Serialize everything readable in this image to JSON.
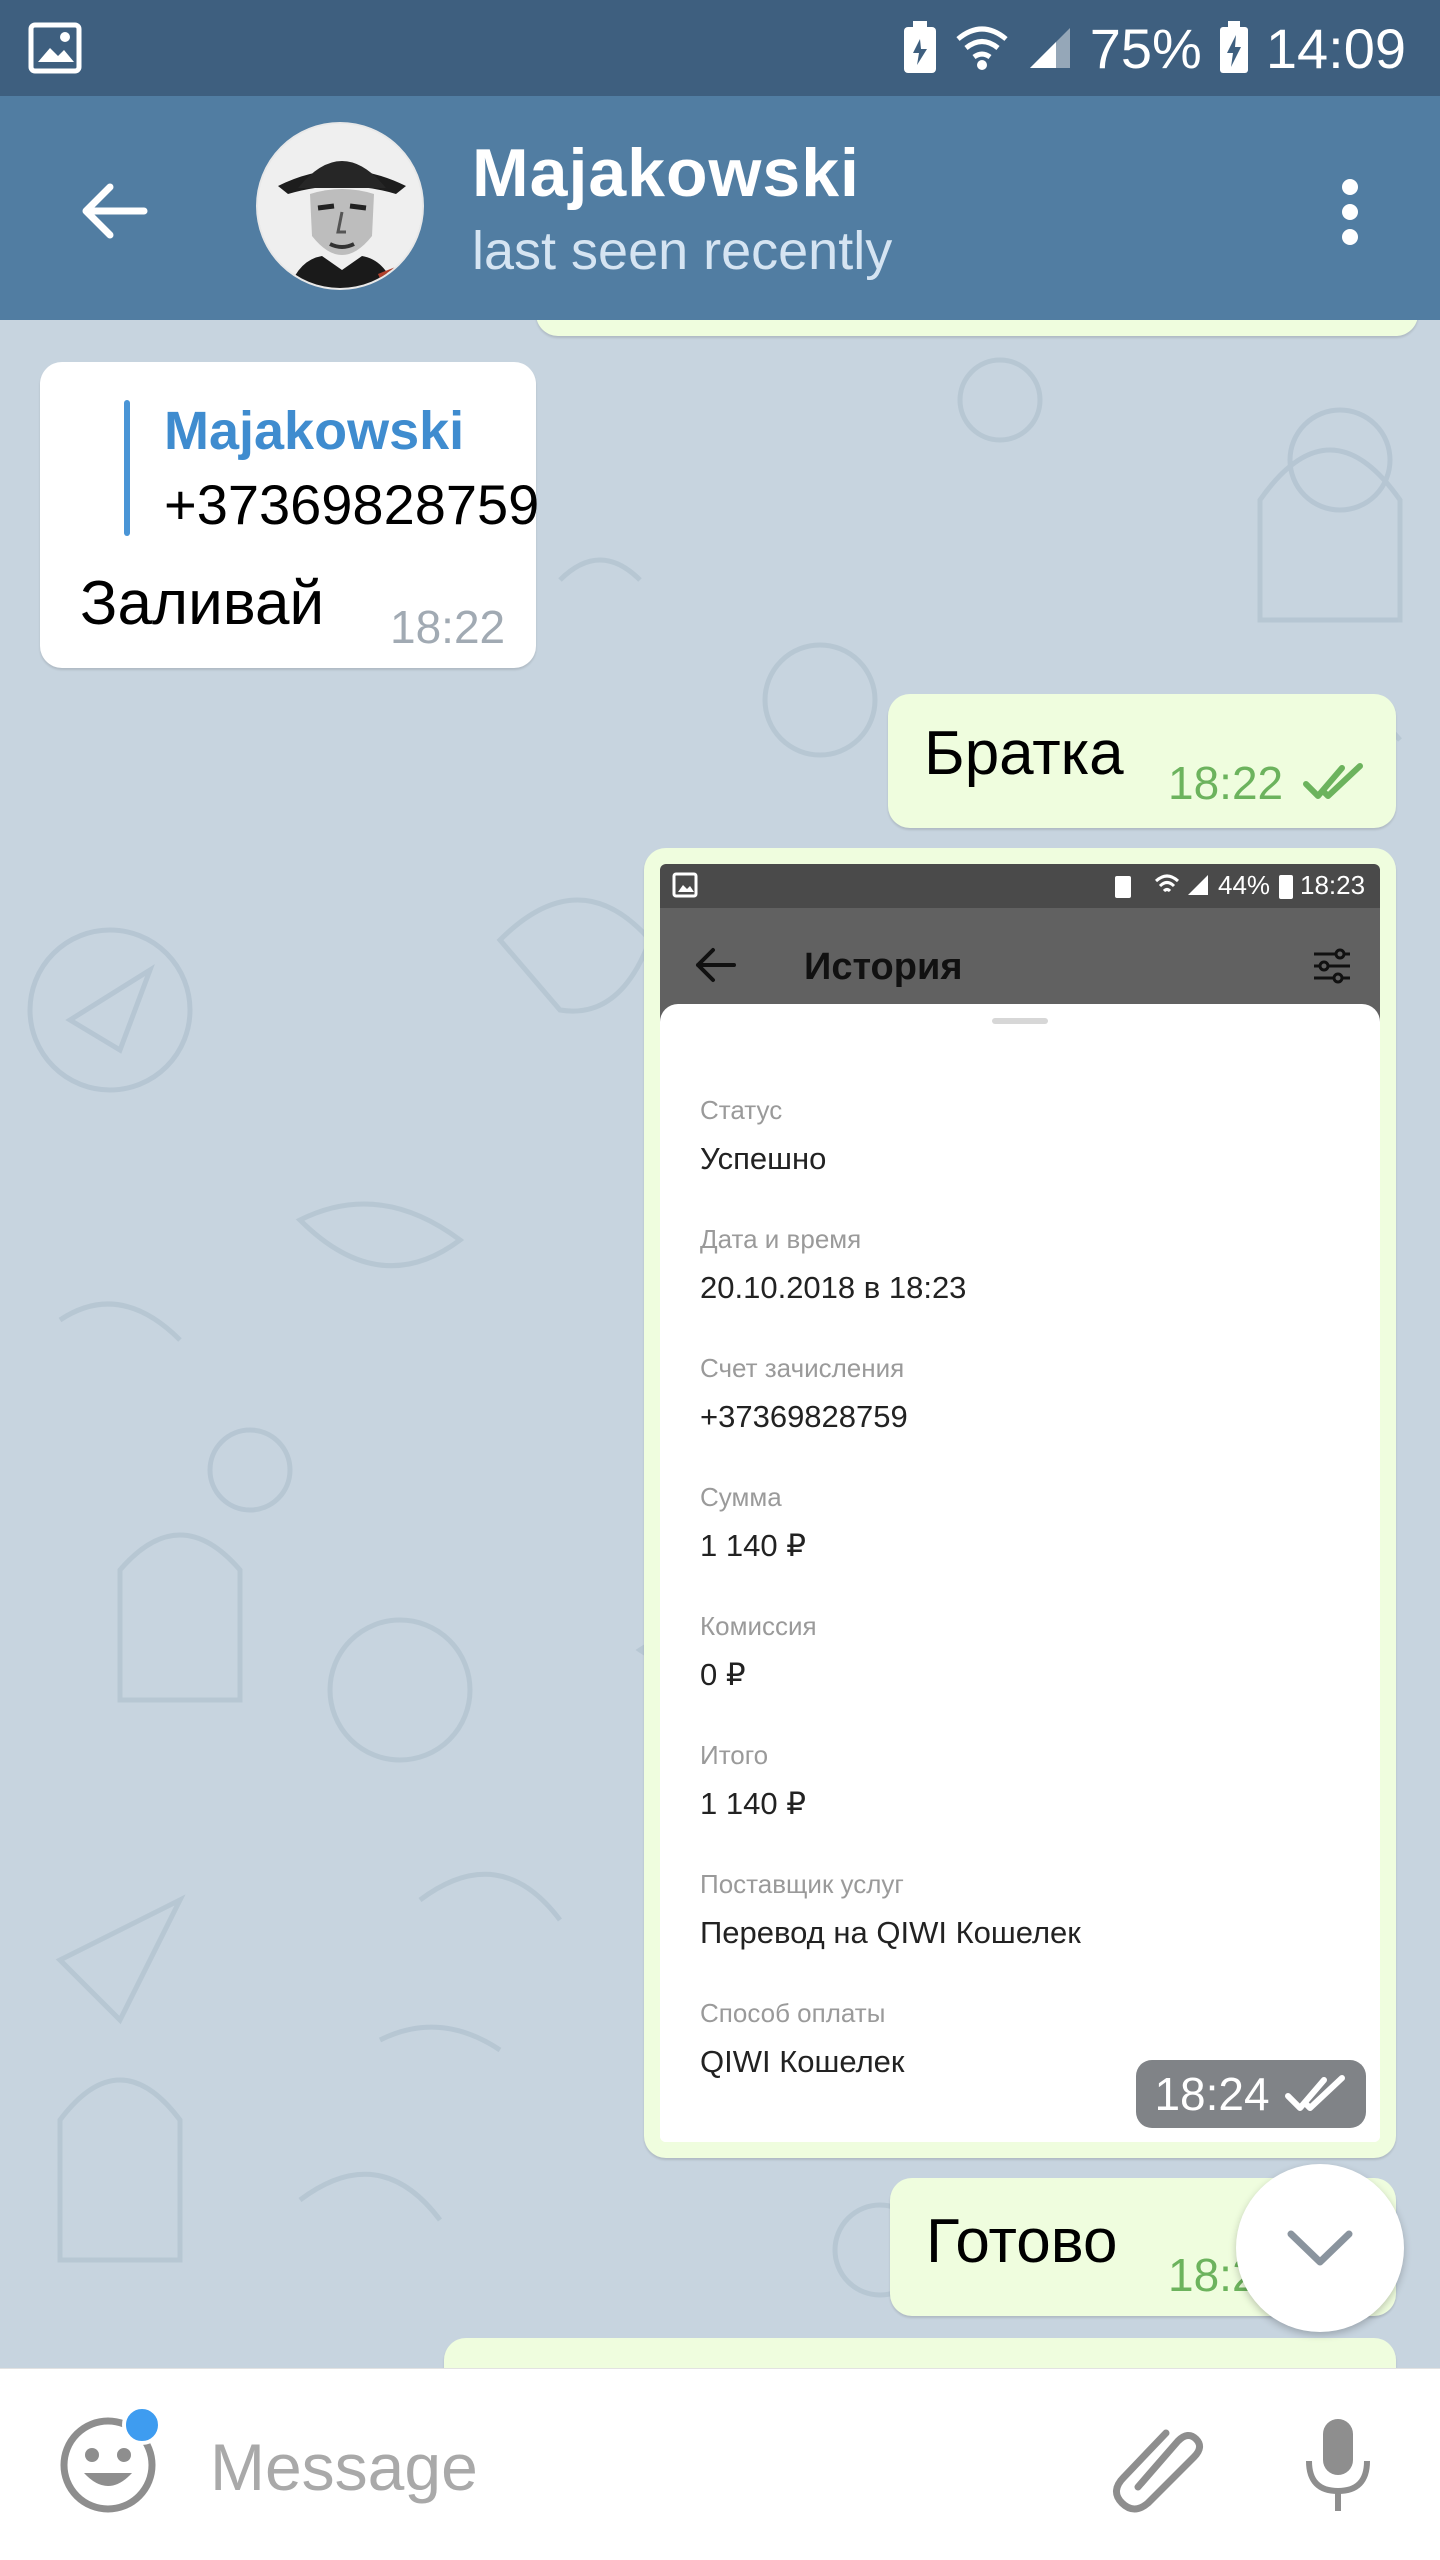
{
  "status_bar": {
    "battery": "75%",
    "time": "14:09"
  },
  "header": {
    "title": "Majakowski",
    "subtitle": "last seen recently",
    "avatar": "portrait-avatar",
    "back_icon": "arrow-left-icon",
    "menu_icon": "more-vert-icon"
  },
  "messages": [
    {
      "direction": "incoming",
      "reply_name": "Majakowski",
      "reply_text": "+37369828759",
      "text": "Заливай",
      "time": "18:22"
    },
    {
      "direction": "outgoing",
      "text": "Братка",
      "time": "18:22",
      "status": "read"
    },
    {
      "direction": "outgoing",
      "type": "photo",
      "time": "18:24",
      "status": "read"
    },
    {
      "direction": "outgoing",
      "text": "Готово",
      "time": "18:2"
    }
  ],
  "photo": {
    "status_battery": "44%",
    "status_time": "18:23",
    "title": "История",
    "fields": [
      {
        "label": "Статус",
        "value": "Успешно"
      },
      {
        "label": "Дата и время",
        "value": "20.10.2018 в 18:23"
      },
      {
        "label": "Счет зачисления",
        "value": "+37369828759"
      },
      {
        "label": "Сумма",
        "value": "1 140 ₽"
      },
      {
        "label": "Комиссия",
        "value": "0 ₽"
      },
      {
        "label": "Итого",
        "value": "1 140 ₽"
      },
      {
        "label": "Поставщик услуг",
        "value": "Перевод на QIWI Кошелек"
      },
      {
        "label": "Способ оплаты",
        "value": "QIWI Кошелек"
      }
    ]
  },
  "input": {
    "placeholder": "Message"
  },
  "colors": {
    "status_bar": "#3e5f7f",
    "app_bar": "#517da2",
    "outgoing_bubble": "#effdde",
    "incoming_bubble": "#ffffff",
    "accent": "#3f8ccf",
    "read_check": "#6cb35d"
  }
}
